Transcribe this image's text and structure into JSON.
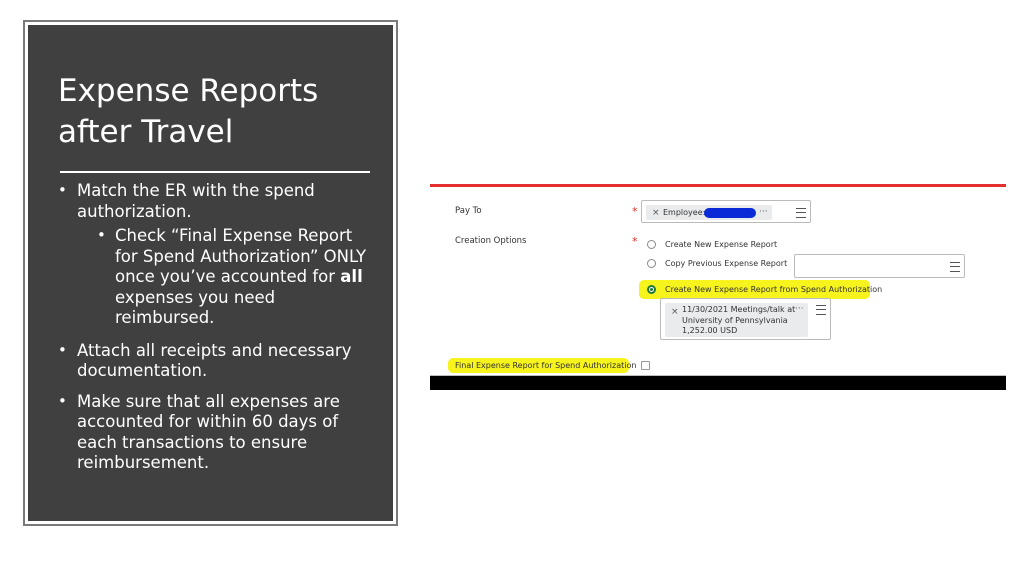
{
  "slide": {
    "title_line1": "Expense Reports",
    "title_line2": "after Travel",
    "bullets": [
      {
        "text": "Match the ER with the spend authorization."
      },
      {
        "sub": true,
        "text_pre": "Check “Final Expense Report for Spend Authorization” ONLY once you’ve accounted for ",
        "bold": "all",
        "text_post": " expenses you need reimbursed."
      },
      {
        "text": "Attach all receipts and necessary documentation."
      },
      {
        "text": "Make sure that all expenses are accounted for within 60 days of each transactions to ensure reimbursement."
      }
    ],
    "bullet_glyph": "•"
  },
  "form": {
    "pay_to_label": "Pay To",
    "pay_to_value": "Employee:",
    "creation_options_label": "Creation Options",
    "required_mark": "*",
    "option_new": "Create New Expense Report",
    "option_copy": "Copy Previous Expense Report",
    "option_from_spend": "Create New Expense Report from Spend Authorization",
    "spend_auth_line1": "11/30/2021 Meetings/talk at",
    "spend_auth_line2": "University of Pennsylvania",
    "spend_auth_line3": "1,252.00 USD",
    "final_report_label": "Final Expense Report for Spend Authorization",
    "remove_glyph": "×",
    "more_glyph": "···",
    "selected_option": "option_from_spend",
    "final_report_checked": false,
    "highlight_color": "#f7f31d",
    "redaction_color": "#0a2ad8",
    "accent_color": "#e3302f"
  }
}
